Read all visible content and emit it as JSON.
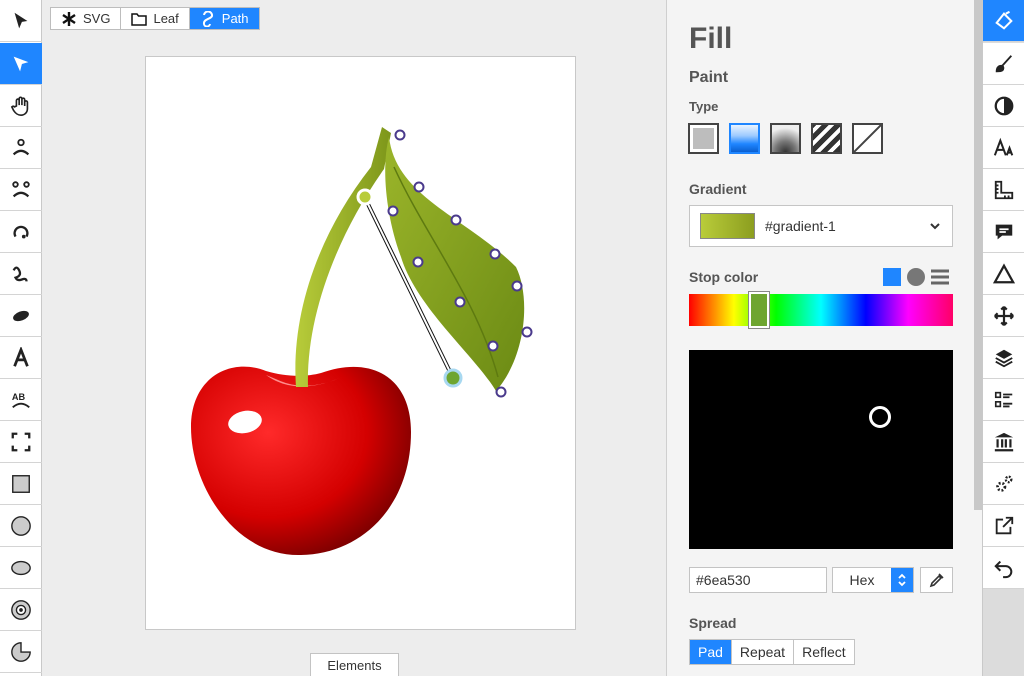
{
  "breadcrumb": [
    {
      "label": "SVG",
      "icon": "asterisk-icon",
      "active": false
    },
    {
      "label": "Leaf",
      "icon": "folder-icon",
      "active": false
    },
    {
      "label": "Path",
      "icon": "path-icon",
      "active": true
    }
  ],
  "left_tools": [
    "arrow-select",
    "direct-select",
    "hand",
    "person-up",
    "person-down",
    "rotate",
    "path-draw",
    "ellipse-fill",
    "text",
    "text-path",
    "crop",
    "rect",
    "circle",
    "ellipse",
    "target",
    "pie"
  ],
  "left_active": "direct-select",
  "right_tools": [
    "paint-fill",
    "brush",
    "contrast",
    "font-size",
    "ruler",
    "comment",
    "triangle",
    "move",
    "layers",
    "list",
    "library",
    "settings",
    "export",
    "undo"
  ],
  "right_active": "paint-fill",
  "canvas": {
    "elements_button": "Elements"
  },
  "panel": {
    "title": "Fill",
    "paint_label": "Paint",
    "type_label": "Type",
    "paint_types": [
      "flat",
      "linear-gradient",
      "radial-gradient",
      "pattern",
      "none"
    ],
    "active_type": "linear-gradient",
    "gradient_label": "Gradient",
    "gradient_name": "#gradient-1",
    "stop_color_label": "Stop color",
    "hex_value": "#6ea530",
    "format": "Hex",
    "spread_label": "Spread",
    "spread_options": [
      "Pad",
      "Repeat",
      "Reflect"
    ],
    "spread_active": "Pad"
  },
  "colors": {
    "accent": "#1f86ff",
    "stop": "#6ea530",
    "cherry": "#d40000",
    "stem": "#8fa81d"
  }
}
